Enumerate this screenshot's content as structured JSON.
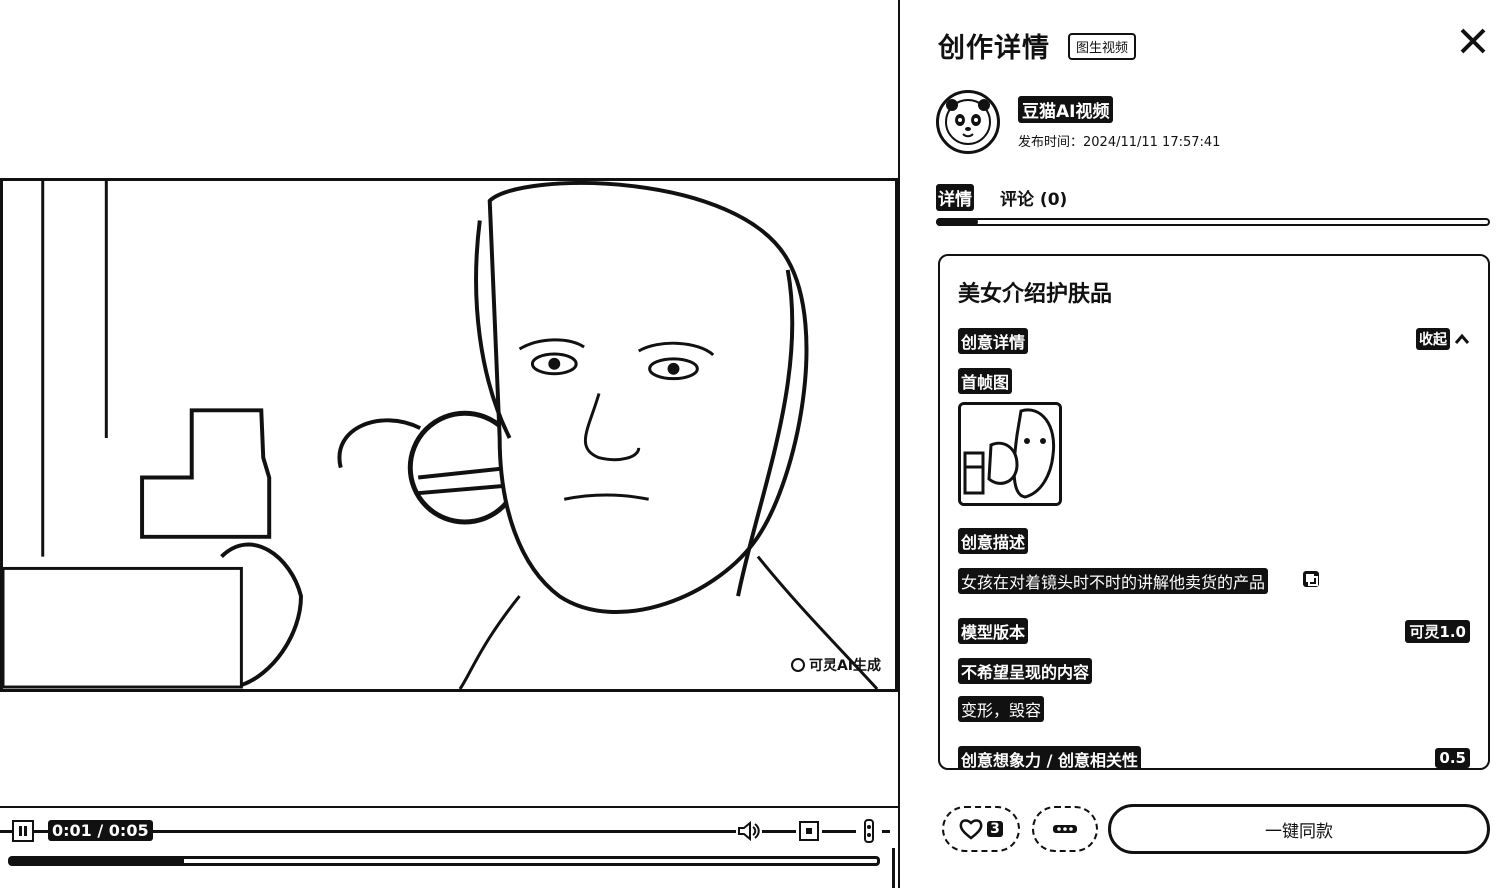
{
  "player": {
    "time": "0:01 / 0:05",
    "progress": 0.2,
    "watermark": "可灵AI生成"
  },
  "panel": {
    "title": "创作详情",
    "mode_badge": "图生视频",
    "author": {
      "name": "豆猫AI视频",
      "publish_time": "发布时间：2024/11/11 17:57:41"
    },
    "tabs": [
      {
        "label": "详情",
        "active": true
      },
      {
        "label": "评论 (0)",
        "active": false
      }
    ]
  },
  "detail": {
    "title": "美女介绍护肤品",
    "creative_details_label": "创意详情",
    "collapse_label": "收起",
    "first_frame_label": "首帧图",
    "description_label": "创意描述",
    "description": "女孩在对着镜头时不时的讲解他卖货的产品",
    "model_label": "模型版本",
    "model_value": "可灵1.0",
    "negative_label": "不希望呈现的内容",
    "negative_value": "变形，毁容",
    "relevance_label": "创意想象力 / 创意相关性",
    "relevance_value": "0.5"
  },
  "actions": {
    "like_count": "3",
    "primary_label": "一键同款"
  }
}
